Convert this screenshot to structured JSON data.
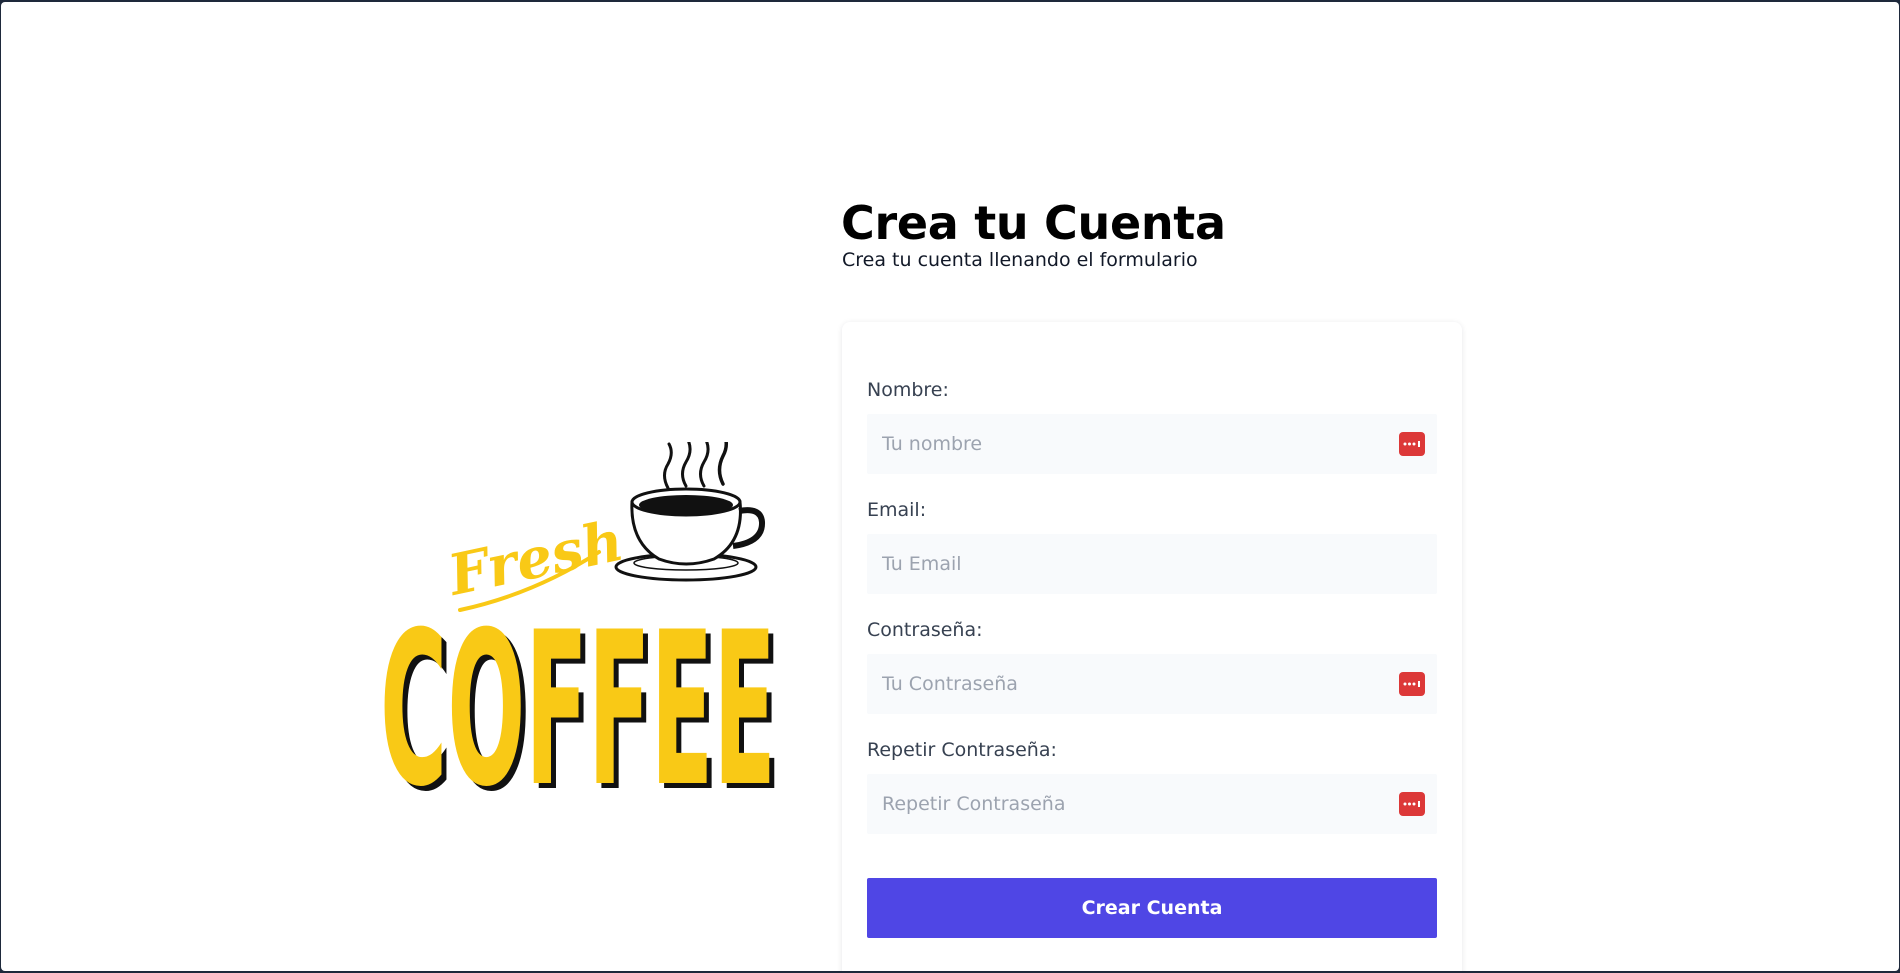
{
  "page": {
    "title": "Crea tu Cuenta",
    "subtitle": "Crea tu cuenta llenando el formulario"
  },
  "logo": {
    "script_text": "Fresh",
    "main_text": "COFFEE",
    "icon": "coffee-cup-icon",
    "color": "#f9c916"
  },
  "form": {
    "fields": [
      {
        "label": "Nombre:",
        "placeholder": "Tu nombre",
        "type": "text",
        "value": "",
        "icon": "password-manager-icon"
      },
      {
        "label": "Email:",
        "placeholder": "Tu Email",
        "type": "email",
        "value": ""
      },
      {
        "label": "Contraseña:",
        "placeholder": "Tu Contraseña",
        "type": "password",
        "value": "",
        "icon": "password-manager-icon"
      },
      {
        "label": "Repetir Contraseña:",
        "placeholder": "Repetir Contraseña",
        "type": "password",
        "value": "",
        "icon": "password-manager-icon"
      }
    ],
    "submit_label": "Crear Cuenta"
  },
  "colors": {
    "accent": "#4f46e5",
    "field_background": "#f8fafc",
    "password_icon": "#dc3838"
  }
}
